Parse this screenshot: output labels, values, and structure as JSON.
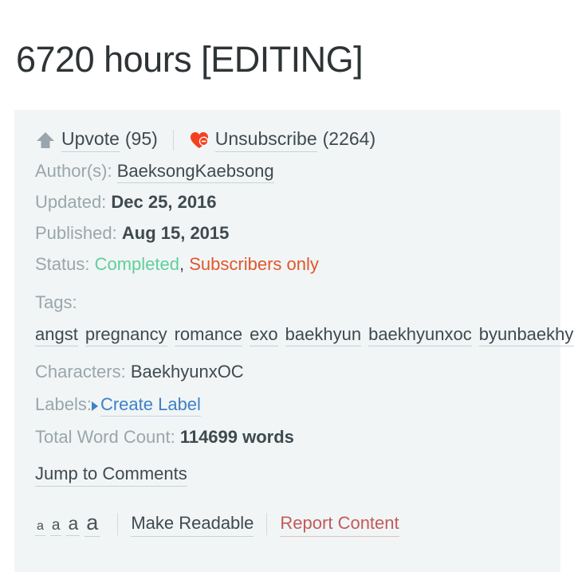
{
  "title": "6720 hours [EDITING]",
  "actions": {
    "upvote": {
      "icon": "arrow-up-icon",
      "label": "Upvote",
      "count": "(95)"
    },
    "unsubscribe": {
      "icon": "heart-minus-icon",
      "label": "Unsubscribe",
      "count": "(2264)"
    }
  },
  "meta": {
    "author_label": "Author(s):",
    "author_value": "BaeksongKaebsong",
    "updated_label": "Updated:",
    "updated_value": "Dec 25, 2016",
    "published_label": "Published:",
    "published_value": "Aug 15, 2015",
    "status_label": "Status:",
    "status_completed": "Completed",
    "status_separator": ",",
    "status_access": "Subscribers only",
    "tags_label": "Tags:",
    "tags": [
      "angst",
      "pregnancy",
      "romance",
      "exo",
      "baekhyun",
      "baekhyunxoc",
      "byunbaekhyunexo"
    ],
    "characters_label": "Characters:",
    "characters_value": "BaekhyunxOC",
    "labels_label": "Labels:",
    "create_label": "Create Label",
    "wordcount_label": "Total Word Count:",
    "wordcount_value": "114699 words"
  },
  "jump_to_comments": "Jump to Comments",
  "toolbar": {
    "font_sizes": [
      "a",
      "a",
      "a",
      "a"
    ],
    "make_readable": "Make Readable",
    "report_content": "Report Content"
  },
  "colors": {
    "panel_background": "#f1f5f6",
    "text": "#3f4a4f",
    "muted_label": "#9aa6ab",
    "status_completed": "#5fd099",
    "status_access": "#e2562a",
    "link_blue": "#3d81c7",
    "report_red": "#c25b5b",
    "heart_red": "#f4401f",
    "arrow_grey": "#9aa5ad"
  }
}
